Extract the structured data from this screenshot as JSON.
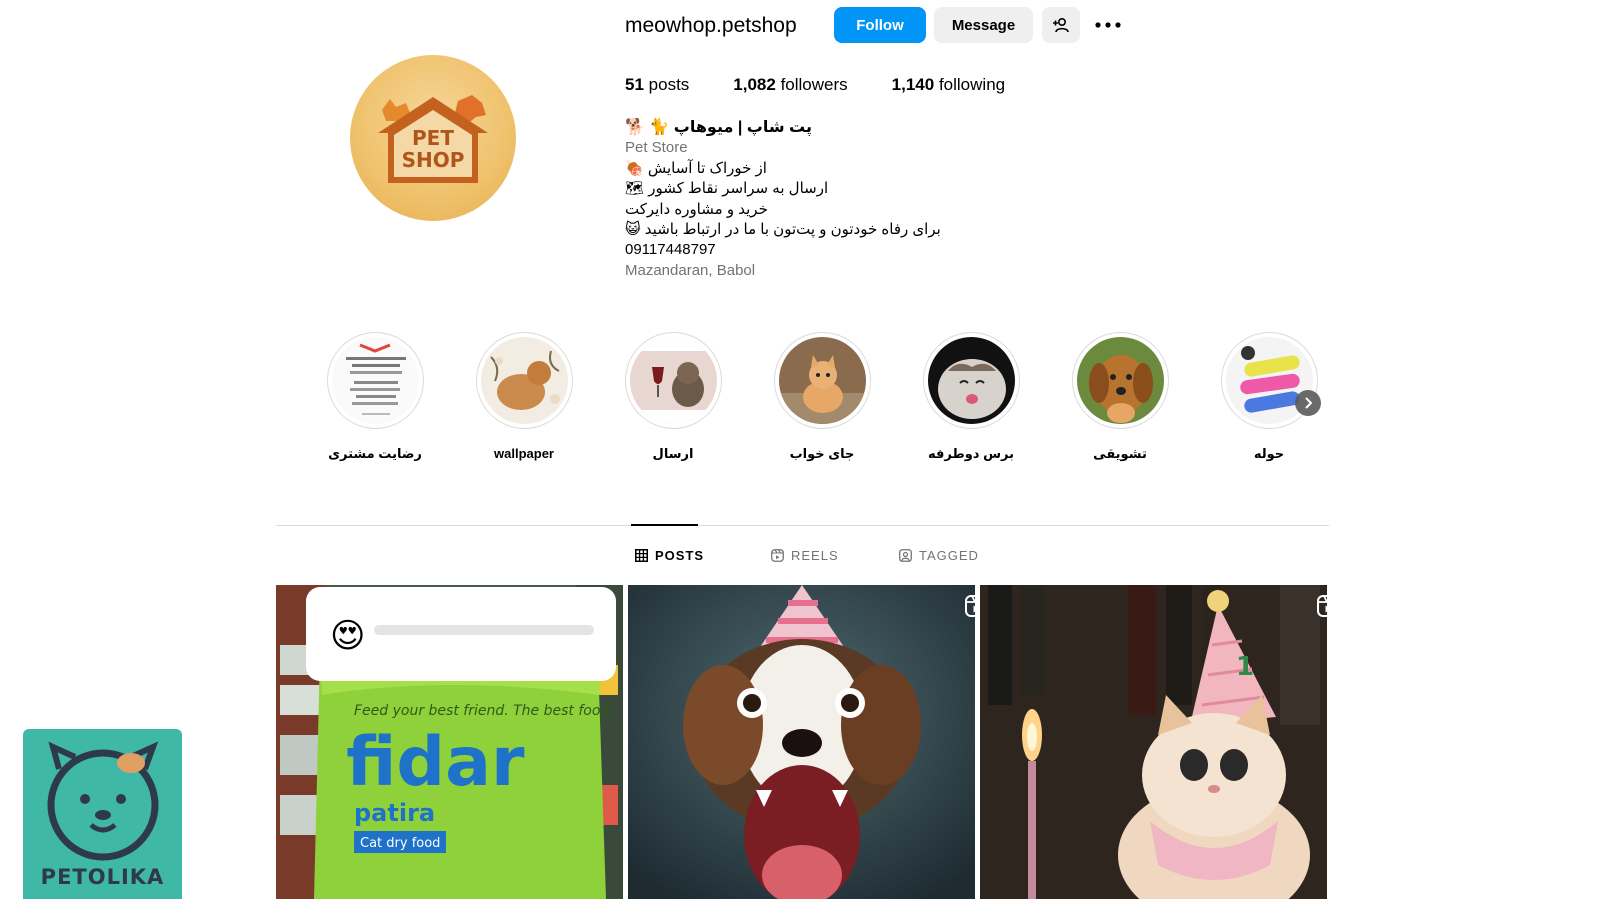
{
  "profile": {
    "username": "meowhop.petshop",
    "follow_label": "Follow",
    "message_label": "Message",
    "logo_text_top": "PET",
    "logo_text_bottom": "SHOP"
  },
  "stats": {
    "posts_count": "51",
    "posts_label": "posts",
    "followers_count": "1,082",
    "followers_label": "followers",
    "following_count": "1,140",
    "following_label": "following"
  },
  "bio": {
    "name": "پت شاپ | میوهاپ 🐈 🐕",
    "category": "Pet Store",
    "line1": "از خوراک تا آسایش 🍖",
    "line2": "ارسال به سراسر نقاط کشور 🗺",
    "line3": "خرید و مشاوره دایرکت",
    "line4": "برای رفاه خودتون و پت‌تون با ما در ارتباط باشید 😺",
    "phone": "09117448797",
    "location": "Mazandaran, Babol"
  },
  "highlights": [
    {
      "label": "رضایت مشتری"
    },
    {
      "label": "wallpaper"
    },
    {
      "label": "ارسال"
    },
    {
      "label": "جای خواب"
    },
    {
      "label": "برس دوطرفه"
    },
    {
      "label": "تشویقی"
    },
    {
      "label": "حوله"
    }
  ],
  "tabs": {
    "posts": "POSTS",
    "reels": "REELS",
    "tagged": "TAGGED"
  },
  "posts": {
    "p1_sticker_emoji": "😍",
    "p1_bag_tagline": "Feed your best friend. The best food",
    "p1_bag_brand": "fidar",
    "p1_bag_sub": "patira",
    "p1_bag_label": "Cat dry food",
    "p3_hat_number": "1"
  },
  "watermark": {
    "text": "PETOLIKA"
  },
  "colors": {
    "accent": "#0095f6",
    "secondary_button": "#efefef",
    "muted_text": "#737373",
    "watermark_bg": "#3fb8a7"
  },
  "icons": [
    "add-person-icon",
    "more-icon",
    "grid-icon",
    "reels-icon",
    "tagged-icon",
    "chevron-right-icon",
    "reel-badge-icon"
  ]
}
